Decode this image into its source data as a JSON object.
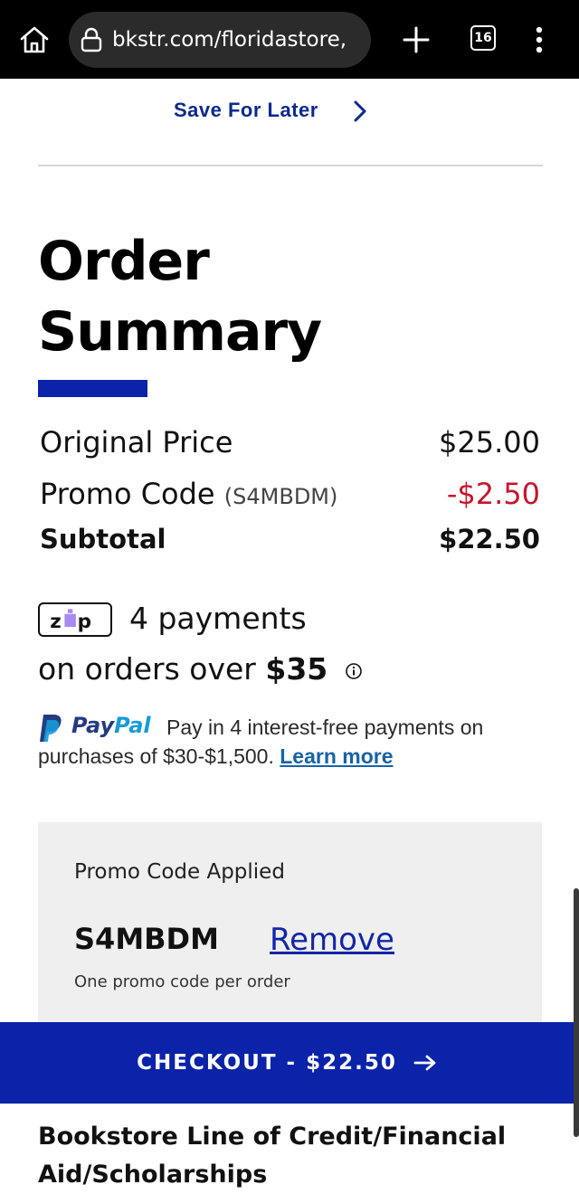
{
  "browser": {
    "url": "bkstr.com/floridastore,",
    "tab_count": "16",
    "icons": [
      "home-icon",
      "lock-icon",
      "plus-icon",
      "tabs-icon",
      "more-vert-icon"
    ]
  },
  "save_for_later": "Save For Later",
  "order_summary": {
    "title": "Order Summary",
    "original_price_label": "Original Price",
    "original_price": "$25.00",
    "promo_label": "Promo Code",
    "promo_code_paren": "(S4MBDM)",
    "promo_discount": "-$2.50",
    "subtotal_label": "Subtotal",
    "subtotal": "$22.50"
  },
  "zip": {
    "logo_text": "zip",
    "line1": "4 payments",
    "line2_prefix": "on orders over",
    "amount": "$35"
  },
  "paypal": {
    "brand_pay": "Pay",
    "brand_pal": "Pal",
    "line1": "Pay in 4 interest-free payments on",
    "line2": "purchases of $30-$1,500.",
    "link": "Learn more"
  },
  "promo_box": {
    "heading": "Promo Code Applied",
    "code": "S4MBDM",
    "remove": "Remove",
    "note": "One promo code per order"
  },
  "checkout": {
    "label": "CHECKOUT - $22.50"
  },
  "credit_section": {
    "title": "Bookstore Line of Credit/Financial Aid/Scholarships"
  },
  "colors": {
    "brand_blue": "#0a23a8",
    "link_blue": "#1763a6",
    "discount_red": "#c5162c",
    "paypal_dark": "#253b80",
    "paypal_light": "#179bd7"
  }
}
